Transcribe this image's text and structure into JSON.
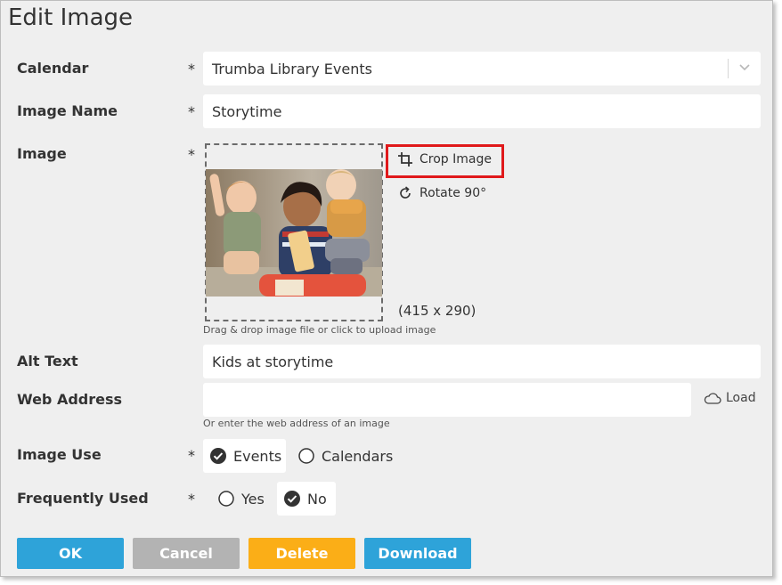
{
  "title": "Edit Image",
  "required_mark": "*",
  "calendar": {
    "label": "Calendar",
    "value": "Trumba Library Events"
  },
  "image_name": {
    "label": "Image Name",
    "value": "Storytime"
  },
  "image": {
    "label": "Image",
    "crop_label": "Crop Image",
    "rotate_label": "Rotate 90°",
    "dimensions": "(415 x 290)",
    "dropzone_hint": "Drag & drop image file or click to upload image"
  },
  "alt_text": {
    "label": "Alt Text",
    "value": "Kids at storytime"
  },
  "web_address": {
    "label": "Web Address",
    "value": "",
    "hint": "Or enter the web address of an image",
    "load_label": "Load"
  },
  "image_use": {
    "label": "Image Use",
    "options": [
      {
        "label": "Events",
        "checked": true
      },
      {
        "label": "Calendars",
        "checked": false
      }
    ]
  },
  "frequently_used": {
    "label": "Frequently Used",
    "options": [
      {
        "label": "Yes",
        "checked": false
      },
      {
        "label": "No",
        "checked": true
      }
    ]
  },
  "buttons": {
    "ok": "OK",
    "cancel": "Cancel",
    "delete": "Delete",
    "download": "Download"
  },
  "colors": {
    "ok": "#2ea3d9",
    "cancel": "#b3b3b3",
    "delete": "#fbae17",
    "download": "#2ea3d9",
    "highlight": "#e0191b"
  }
}
